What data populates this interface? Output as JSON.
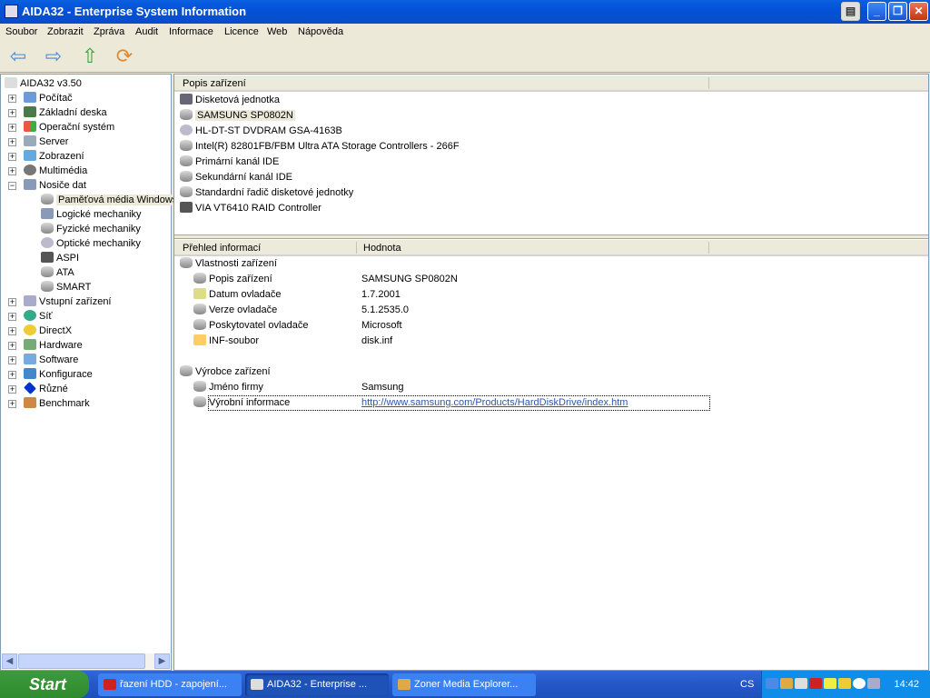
{
  "window": {
    "title": "AIDA32 - Enterprise System Information"
  },
  "menu": [
    "Soubor",
    "Zobrazit",
    "Zpráva",
    "Audit",
    "Informace",
    "Licence",
    "Web",
    "Nápověda"
  ],
  "toolbar": {
    "icons": [
      "back-arrow-icon",
      "forward-arrow-icon",
      "up-arrow-icon",
      "refresh-icon"
    ]
  },
  "tree": {
    "root": "AIDA32 v3.50",
    "items": [
      {
        "label": "Počítač",
        "level": 1,
        "exp": "+",
        "icon": "computer"
      },
      {
        "label": "Základní deska",
        "level": 1,
        "exp": "+",
        "icon": "motherboard"
      },
      {
        "label": "Operační systém",
        "level": 1,
        "exp": "+",
        "icon": "windows"
      },
      {
        "label": "Server",
        "level": 1,
        "exp": "+",
        "icon": "server"
      },
      {
        "label": "Zobrazení",
        "level": 1,
        "exp": "+",
        "icon": "display"
      },
      {
        "label": "Multimédia",
        "level": 1,
        "exp": "+",
        "icon": "speaker"
      },
      {
        "label": "Nosiče dat",
        "level": 1,
        "exp": "-",
        "icon": "storage"
      },
      {
        "label": "Paměťová média Windows",
        "level": 2,
        "icon": "hdd",
        "selected": true
      },
      {
        "label": "Logické mechaniky",
        "level": 2,
        "icon": "storage"
      },
      {
        "label": "Fyzické mechaniky",
        "level": 2,
        "icon": "hdd"
      },
      {
        "label": "Optické mechaniky",
        "level": 2,
        "icon": "cd"
      },
      {
        "label": "ASPI",
        "level": 2,
        "icon": "aspi"
      },
      {
        "label": "ATA",
        "level": 2,
        "icon": "hdd"
      },
      {
        "label": "SMART",
        "level": 2,
        "icon": "hdd"
      },
      {
        "label": "Vstupní zařízení",
        "level": 1,
        "exp": "+",
        "icon": "keyboard"
      },
      {
        "label": "Síť",
        "level": 1,
        "exp": "+",
        "icon": "network"
      },
      {
        "label": "DirectX",
        "level": 1,
        "exp": "+",
        "icon": "directx"
      },
      {
        "label": "Hardware",
        "level": 1,
        "exp": "+",
        "icon": "hardware"
      },
      {
        "label": "Software",
        "level": 1,
        "exp": "+",
        "icon": "software"
      },
      {
        "label": "Konfigurace",
        "level": 1,
        "exp": "+",
        "icon": "config"
      },
      {
        "label": "Různé",
        "level": 1,
        "exp": "+",
        "icon": "diamond"
      },
      {
        "label": "Benchmark",
        "level": 1,
        "exp": "+",
        "icon": "hourglass"
      }
    ]
  },
  "devices": {
    "header": "Popis zařízení",
    "items": [
      {
        "label": "Disketová jednotka",
        "icon": "floppy"
      },
      {
        "label": "SAMSUNG SP0802N",
        "icon": "hdd",
        "selected": true
      },
      {
        "label": "HL-DT-ST DVDRAM GSA-4163B",
        "icon": "cd"
      },
      {
        "label": "Intel(R) 82801FB/FBM Ultra ATA Storage Controllers - 266F",
        "icon": "controller"
      },
      {
        "label": "Primární kanál IDE",
        "icon": "controller"
      },
      {
        "label": "Sekundární kanál IDE",
        "icon": "controller"
      },
      {
        "label": "Standardní řadič disketové jednotky",
        "icon": "controller"
      },
      {
        "label": "VIA VT6410 RAID Controller",
        "icon": "aspi"
      }
    ]
  },
  "details": {
    "headers": [
      "Přehled informací",
      "Hodnota"
    ],
    "rows": [
      {
        "label": "Vlastnosti zařízení",
        "group": true,
        "icon": "hdd"
      },
      {
        "label": "Popis zařízení",
        "value": "SAMSUNG SP0802N",
        "icon": "hdd"
      },
      {
        "label": "Datum ovladače",
        "value": "1.7.2001",
        "icon": "driver"
      },
      {
        "label": "Verze ovladače",
        "value": "5.1.2535.0",
        "icon": "hdd"
      },
      {
        "label": "Poskytovatel ovladače",
        "value": "Microsoft",
        "icon": "hdd"
      },
      {
        "label": "INF-soubor",
        "value": "disk.inf",
        "icon": "inf"
      },
      {
        "spacer": true
      },
      {
        "label": "Výrobce zařízení",
        "group": true,
        "icon": "hdd"
      },
      {
        "label": "Jméno firmy",
        "value": "Samsung",
        "icon": "hdd"
      },
      {
        "label": "Výrobní informace",
        "value": "http://www.samsung.com/Products/HardDiskDrive/index.htm",
        "link": true,
        "icon": "link",
        "focused": true
      }
    ]
  },
  "taskbar": {
    "start": "Start",
    "tasks": [
      {
        "label": "řazení HDD - zapojení...",
        "icon": "opera"
      },
      {
        "label": "AIDA32 - Enterprise ...",
        "icon": "aida",
        "active": true
      },
      {
        "label": "Zoner Media Explorer...",
        "icon": "zoner"
      }
    ],
    "lang": "CS",
    "clock": "14:42"
  }
}
